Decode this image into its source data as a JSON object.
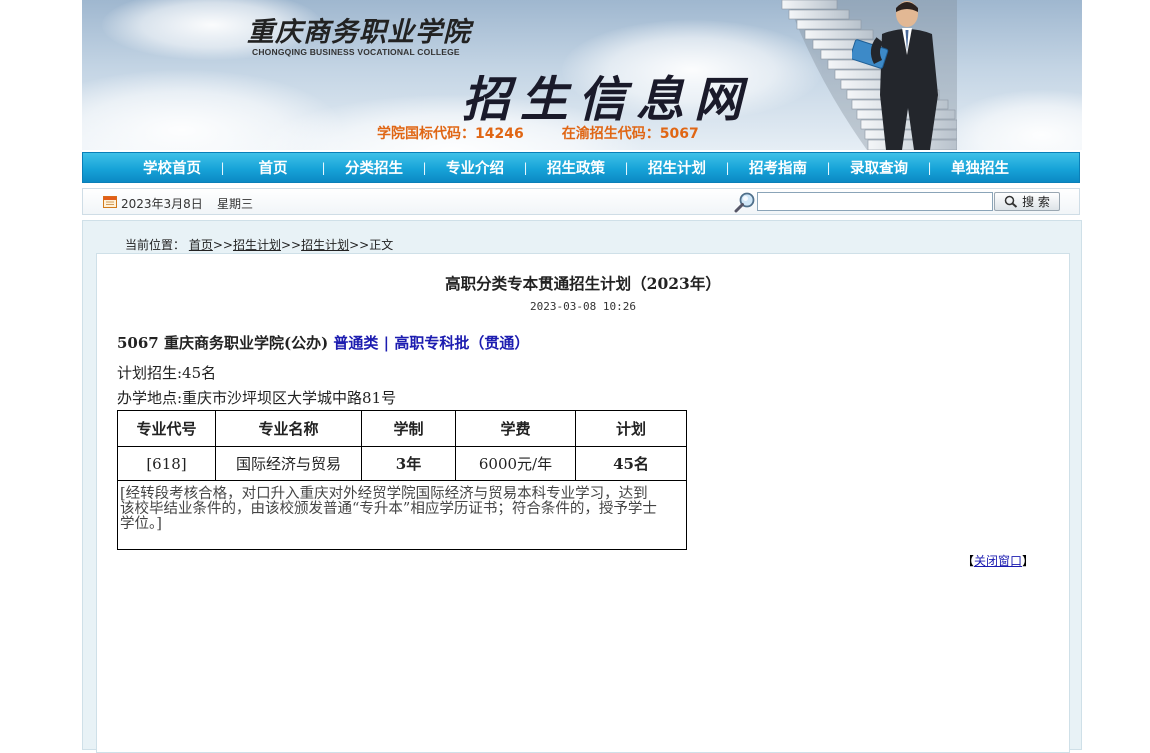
{
  "header": {
    "college_name_cn": "重庆商务职业学院",
    "college_name_en": "CHONGQING BUSINESS VOCATIONAL COLLEGE",
    "site_title": "招生信息网",
    "national_code": "学院国标代码：14246",
    "local_code": "在渝招生代码：5067"
  },
  "nav": {
    "items": [
      {
        "label": "学校首页"
      },
      {
        "label": "首页"
      },
      {
        "label": "分类招生"
      },
      {
        "label": "专业介绍"
      },
      {
        "label": "招生政策"
      },
      {
        "label": "招生计划"
      },
      {
        "label": "招考指南"
      },
      {
        "label": "录取查询"
      },
      {
        "label": "单独招生"
      }
    ],
    "separator": "|"
  },
  "datebar": {
    "date": "2023年3月8日",
    "weekday": "星期三",
    "search_value": "",
    "search_button": "搜 索"
  },
  "breadcrumb": {
    "prefix": "当前位置：",
    "items": [
      "首页",
      "招生计划",
      "招生计划"
    ],
    "sep": ">>",
    "current": "正文"
  },
  "article": {
    "title": "高职分类专本贯通招生计划（2023年）",
    "time": "2023-03-08 10:26",
    "school_code": "5067",
    "school_name": "重庆商务职业学院(公办)",
    "category": "普通类",
    "divider": "|",
    "batch": "高职专科批（贯通）",
    "plan_total": "计划招生:45名",
    "location": "办学地点:重庆市沙坪坝区大学城中路81号",
    "table": {
      "headers": [
        "专业代号",
        "专业名称",
        "学制",
        "学费",
        "计划"
      ],
      "rows": [
        [
          "[618]",
          "国际经济与贸易",
          "3年",
          "6000元/年",
          "45名"
        ]
      ],
      "note": "[经转段考核合格，对口升入重庆对外经贸学院国际经济与贸易本科专业学习，达到该校毕结业条件的，由该校颁发普通“专升本”相应学历证书；符合条件的，授予学士学位。]"
    },
    "close_open": "【",
    "close_label": "关闭窗口",
    "close_end": "】"
  }
}
